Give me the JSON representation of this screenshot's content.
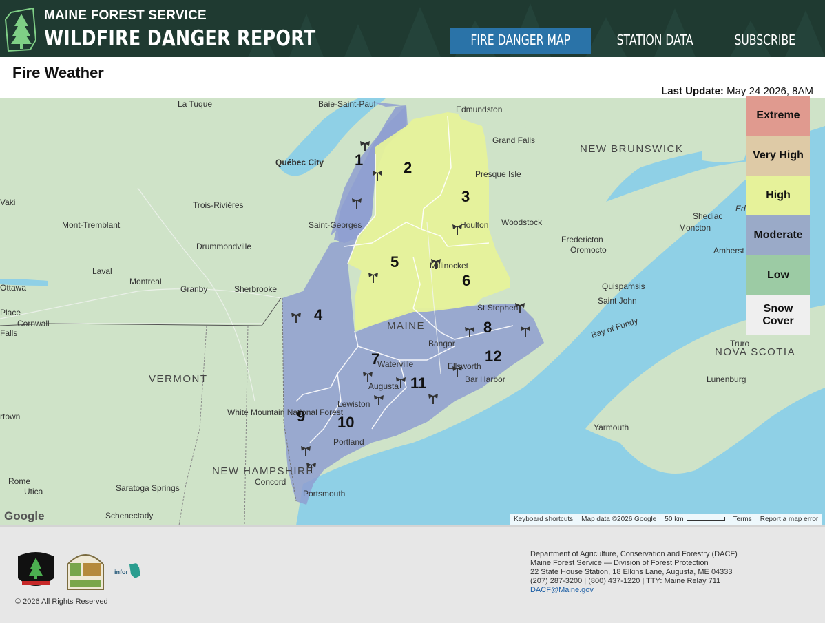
{
  "header": {
    "org": "MAINE FOREST SERVICE",
    "title": "WILDFIRE DANGER REPORT",
    "nav": [
      {
        "label": "FIRE DANGER MAP",
        "active": true
      },
      {
        "label": "STATION DATA",
        "active": false
      },
      {
        "label": "SUBSCRIBE",
        "active": false
      }
    ]
  },
  "page": {
    "heading": "Fire Weather",
    "last_update_label": "Last Update:",
    "last_update_value": "May 24 2026, 8AM"
  },
  "legend": [
    {
      "label": "Extreme",
      "color": "#e09a8f"
    },
    {
      "label": "Very High",
      "color": "#decaa6"
    },
    {
      "label": "High",
      "color": "#e6f29a"
    },
    {
      "label": "Moderate",
      "color": "#9aaac8"
    },
    {
      "label": "Low",
      "color": "#9ccba4"
    },
    {
      "label": "Snow Cover",
      "color": "#efefef"
    }
  ],
  "zones": [
    {
      "id": "1",
      "level": "Moderate"
    },
    {
      "id": "2",
      "level": "High"
    },
    {
      "id": "3",
      "level": "High"
    },
    {
      "id": "4",
      "level": "Moderate"
    },
    {
      "id": "5",
      "level": "High"
    },
    {
      "id": "6",
      "level": "High"
    },
    {
      "id": "7",
      "level": "Moderate"
    },
    {
      "id": "8",
      "level": "Moderate"
    },
    {
      "id": "9",
      "level": "Moderate"
    },
    {
      "id": "10",
      "level": "Moderate"
    },
    {
      "id": "11",
      "level": "Moderate"
    },
    {
      "id": "12",
      "level": "Moderate"
    }
  ],
  "map": {
    "places": [
      "La Tuque",
      "Baie-Saint-Paul",
      "Edmundston",
      "Québec City",
      "Grand Falls",
      "Trois-Rivières",
      "Presque Isle",
      "Mont-Tremblant",
      "Saint-Georges",
      "Woodstock",
      "Houlton",
      "Drummondville",
      "Fredericton",
      "Oromocto",
      "Shediac",
      "Moncton",
      "Laval",
      "Montreal",
      "Granby",
      "Sherbrooke",
      "Millinocket",
      "Amherst",
      "Ottawa",
      "Quispamsis",
      "Saint John",
      "Cornwall",
      "St Stephen",
      "Bangor",
      "Waterville",
      "Ellsworth",
      "Augusta",
      "Bar Harbor",
      "Lewiston",
      "Portland",
      "Concord",
      "Portsmouth",
      "Saratoga Springs",
      "Schenectady",
      "Rome",
      "Utica",
      "Truro",
      "Lunenburg",
      "Yarmouth",
      "Place",
      "Falls",
      "Vaki",
      "Ed",
      "rtown"
    ],
    "regions": [
      "NEW BRUNSWICK",
      "VERMONT",
      "NOVA SCOTIA",
      "NEW HAMPSHIRE",
      "MAINE"
    ],
    "poi": [
      "White Mountain National Forest"
    ],
    "water": [
      "Bay of Fundy"
    ],
    "google": "Google",
    "attribution": [
      "Keyboard shortcuts",
      "Map data ©2026 Google",
      "50 km",
      "Terms",
      "Report a map error"
    ]
  },
  "footer": {
    "logos": [
      "FOREST RANGER MAINE FOREST SERVICE",
      "FOREST SERVICE",
      "inforME"
    ],
    "copyright": "© 2026 All Rights Reserved",
    "contact": [
      "Department of Agriculture, Conservation and Forestry (DACF)",
      "Maine Forest Service — Division of Forest Protection",
      "22 State House Station, 18 Elkins Lane, Augusta, ME 04333",
      "(207) 287-3200 | (800) 437-1220 | TTY: Maine Relay 711"
    ],
    "email": "DACF@Maine.gov"
  },
  "colors": {
    "header_bg": "#1f3a31",
    "nav_active": "#2a73a8",
    "water": "#8fd0e6",
    "land": "#cfe3c8"
  }
}
